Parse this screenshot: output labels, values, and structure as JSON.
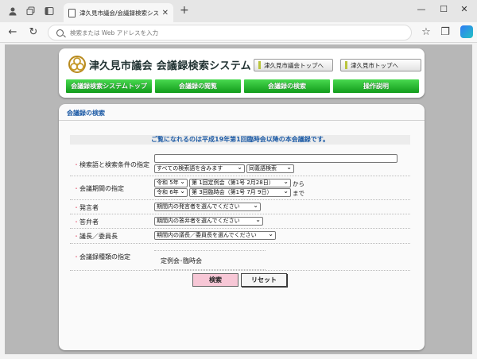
{
  "browser": {
    "tab_title": "津久見市議会/会議録検索システム",
    "omnibox_placeholder": "検索または Web アドレスを入力"
  },
  "header": {
    "site_title": "津久見市議会 会議録検索システム",
    "top_links": [
      "津久見市議会トップへ",
      "津久見市トップへ"
    ],
    "nav": [
      "会議録検索システムトップ",
      "会議録の閲覧",
      "会議録の検索",
      "操作説明"
    ]
  },
  "search": {
    "section_title": "会議録の検索",
    "notice": "ご覧になれるのは平成19年第1回臨時会以降の本会議録です。",
    "rows": {
      "keyword": {
        "label": "検索語と検索条件の指定",
        "keyword_value": "",
        "condition_select": "すべての検索語を含みます",
        "mode_select": "同義語検索"
      },
      "period": {
        "label": "会議期間の指定",
        "from_year": "令和 5年",
        "from_session": "第 1回定例会（第1号 2月28日）",
        "from_suffix": "から",
        "to_year": "令和 6年",
        "to_session": "第 3回臨時会（第1号 7月 9日）",
        "to_suffix": "まで"
      },
      "speaker": {
        "label": "発言者",
        "select": "期間内の発言者を選んでください"
      },
      "answerer": {
        "label": "答弁者",
        "select": "期間内の答弁者を選んでください"
      },
      "chair": {
        "label": "議長／委員長",
        "select": "期間内の議長／委員長を選んでください"
      },
      "meeting_type": {
        "label": "会議録種類の指定",
        "value": "定例会･臨時会"
      }
    },
    "buttons": {
      "search": "検索",
      "reset": "リセット"
    }
  },
  "colors": {
    "nav_green": "#1faa28",
    "link_blue": "#1c5aa5",
    "bullet_red": "#d24444",
    "search_button_pink": "#f7c7d6"
  }
}
